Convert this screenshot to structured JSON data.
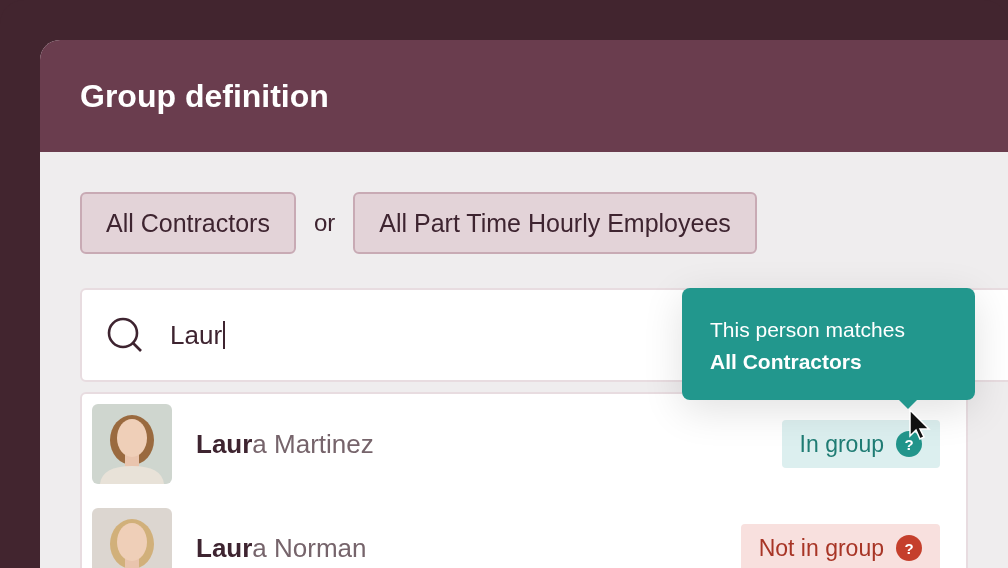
{
  "dialog": {
    "title": "Group definition"
  },
  "criteria": [
    {
      "label": "All Contractors"
    },
    {
      "label": "All Part Time Hourly Employees"
    }
  ],
  "joiner": "or",
  "search": {
    "value": "Laur"
  },
  "tooltip": {
    "text": "This person matches",
    "group": "All Contractors"
  },
  "results": [
    {
      "name": "**Laur**a Martinez",
      "status": "In group",
      "kind": "in",
      "help": "?"
    },
    {
      "name": "**Laur**a Norman",
      "status": "Not in group",
      "kind": "out",
      "help": "?"
    }
  ]
}
